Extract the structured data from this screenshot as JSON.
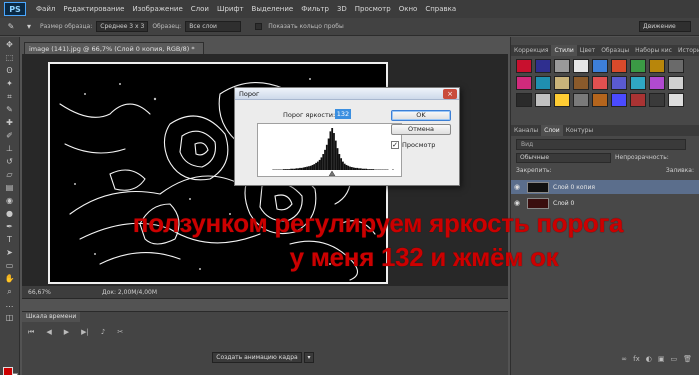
{
  "app": {
    "logo": "PS"
  },
  "menu": [
    "Файл",
    "Редактирование",
    "Изображение",
    "Слои",
    "Шрифт",
    "Выделение",
    "Фильтр",
    "3D",
    "Просмотр",
    "Окно",
    "Справка"
  ],
  "options": {
    "sample_size_label": "Размер образца:",
    "sample_size_value": "Среднее 3 х 3",
    "sample_layers_value": "Все слои",
    "show_ring_label": "Показать кольцо пробы",
    "workspace_value": "Движение"
  },
  "document": {
    "tab_title": "image (141).jpg @ 66,7% (Слой 0 копия, RGB/8) *",
    "zoom": "66,67%",
    "doc_info": "Док: 2,00M/4,00M"
  },
  "dialog": {
    "title": "Порог",
    "level_label": "Порог яркости:",
    "level_value": "132",
    "ok": "OK",
    "cancel": "Отмена",
    "preview_label": "Просмотр",
    "close_glyph": "×",
    "histogram": {
      "threshold": 132,
      "bins": [
        0,
        0,
        0,
        0,
        0,
        0,
        0,
        0,
        1,
        1,
        1,
        1,
        1,
        1,
        2,
        2,
        2,
        2,
        3,
        3,
        3,
        4,
        4,
        5,
        5,
        6,
        7,
        8,
        9,
        10,
        12,
        14,
        17,
        20,
        24,
        30,
        38,
        48,
        60,
        75,
        92,
        100,
        88,
        70,
        52,
        38,
        28,
        20,
        15,
        12,
        10,
        8,
        7,
        6,
        5,
        5,
        4,
        4,
        3,
        3,
        3,
        2,
        2,
        2,
        2,
        1,
        1,
        1,
        1,
        1,
        1,
        1,
        1,
        0,
        0,
        1,
        0,
        0,
        0,
        0
      ]
    }
  },
  "panels": {
    "styles_tabs": [
      "Коррекция",
      "Стили",
      "Цвет",
      "Образцы",
      "Наборы кис",
      "История"
    ],
    "styles_active": "Стили",
    "swatches": [
      "#c8102e",
      "#2f2f8f",
      "#9a9a9a",
      "#e6e6e6",
      "#3d7fd9",
      "#d94a2b",
      "#3b9a45",
      "#b8860b",
      "#6a6a6a",
      "#d12a7c",
      "#1f8fb0",
      "#c9b37a",
      "#8a5a2b",
      "#e05050",
      "#5a5ad0",
      "#2fa7c4",
      "#b04ad0",
      "#d0d0d0",
      "#2a2a2a",
      "#c0c0c0",
      "#ffcc33",
      "#7a7a7a",
      "#b5651d",
      "#4b4bff",
      "#aa3333",
      "#3a3a3a",
      "#dcdcdc"
    ],
    "layers_tabs": [
      "Каналы",
      "Слои",
      "Контуры"
    ],
    "layers_active": "Слои",
    "layers_search": "Вид",
    "blend_mode": "Обычные",
    "opacity_label": "Непрозрачность:",
    "lock_label": "Закрепить:",
    "fill_label": "Заливка:",
    "layers": [
      {
        "name": "Слой 0 копия",
        "selected": true
      },
      {
        "name": "Слой 0",
        "selected": false
      }
    ],
    "footer_icons": [
      "∞",
      "fx",
      "◐",
      "▣",
      "▭",
      "🗑"
    ]
  },
  "timeline": {
    "tab": "Шкала времени",
    "create_button": "Создать анимацию кадра"
  },
  "overlay": {
    "line1": "ползунком регулируем яркость порога",
    "line2": "у меня 132 и жмём ок"
  },
  "colors": {
    "accent": "#3b8fe0",
    "overlay_text": "#cc0000",
    "foreground": "#cc0000",
    "background": "#ffffff"
  }
}
